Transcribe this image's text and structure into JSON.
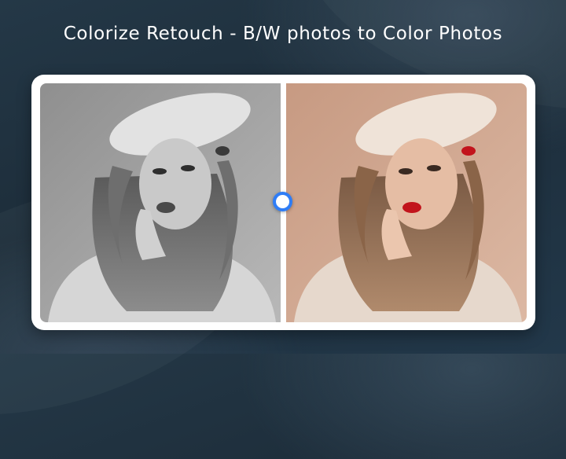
{
  "header": {
    "title": "Colorize Retouch - B/W photos to Color Photos"
  },
  "comparison": {
    "before_label": "black-and-white photo",
    "after_label": "colorized photo",
    "handle_icon": "slider-handle-icon"
  },
  "colors": {
    "background": "#1f3040",
    "frame": "#ffffff",
    "handle_ring": "#2f7df6",
    "bw_backdrop": "#9a9a9a",
    "color_backdrop": "#d2a890",
    "lips": "#c2141c"
  }
}
